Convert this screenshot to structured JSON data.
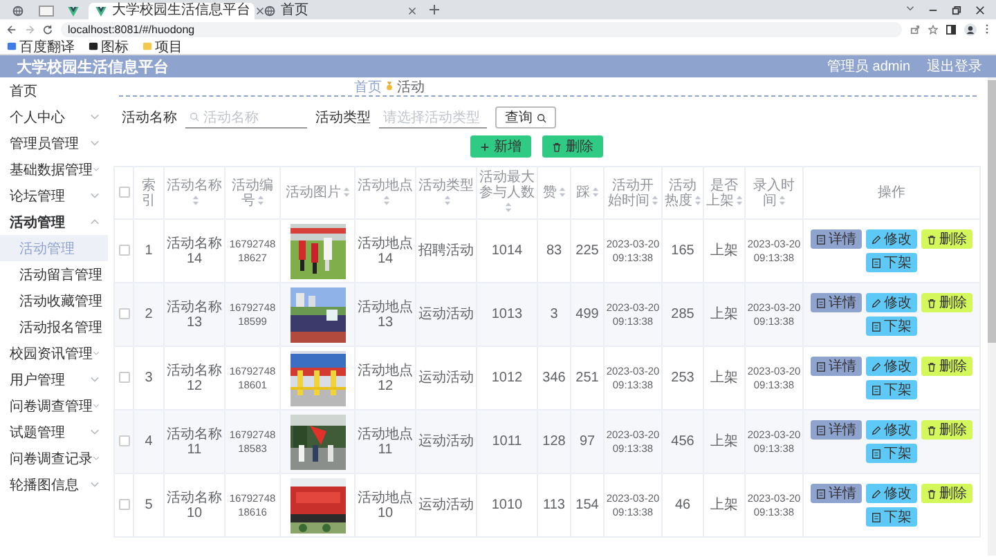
{
  "browser": {
    "tabs": [
      {
        "title": "大学校园生活信息平台",
        "selected": true
      },
      {
        "title": "首页",
        "selected": false
      }
    ],
    "address": "localhost:8081/#/huodong",
    "bookmarks": [
      "百度翻译",
      "图标",
      "项目"
    ]
  },
  "header": {
    "title": "大学校园生活信息平台",
    "user": "管理员 admin",
    "logout": "退出登录"
  },
  "sidebar": {
    "items": [
      {
        "label": "首页",
        "expandable": false,
        "expanded": false
      },
      {
        "label": "个人中心",
        "expandable": true,
        "expanded": false
      },
      {
        "label": "管理员管理",
        "expandable": true,
        "expanded": false
      },
      {
        "label": "基础数据管理",
        "expandable": true,
        "expanded": false
      },
      {
        "label": "论坛管理",
        "expandable": true,
        "expanded": false
      },
      {
        "label": "活动管理",
        "expandable": true,
        "expanded": true,
        "children": [
          {
            "label": "活动管理",
            "selected": true
          },
          {
            "label": "活动留言管理",
            "selected": false
          },
          {
            "label": "活动收藏管理",
            "selected": false
          },
          {
            "label": "活动报名管理",
            "selected": false
          }
        ]
      },
      {
        "label": "校园资讯管理",
        "expandable": true,
        "expanded": false
      },
      {
        "label": "用户管理",
        "expandable": true,
        "expanded": false
      },
      {
        "label": "问卷调查管理",
        "expandable": true,
        "expanded": false
      },
      {
        "label": "试题管理",
        "expandable": true,
        "expanded": false
      },
      {
        "label": "问卷调查记录",
        "expandable": true,
        "expanded": false
      },
      {
        "label": "轮播图信息",
        "expandable": true,
        "expanded": false
      }
    ]
  },
  "breadcrumb": [
    "首页",
    "活动"
  ],
  "search": {
    "fields": [
      {
        "kind": "text",
        "label": "活动名称",
        "placeholder": "活动名称"
      },
      {
        "kind": "select",
        "label": "活动类型",
        "placeholder": "请选择活动类型"
      }
    ],
    "button": "查询"
  },
  "toolbar": [
    "新增",
    "删除"
  ],
  "table": {
    "select_all_checked": false,
    "columns": [
      {
        "kind": "text",
        "label": "索引",
        "sortable": false
      },
      {
        "kind": "text",
        "label": "活动名称",
        "sortable": true
      },
      {
        "kind": "small",
        "label": "活动编号",
        "sortable": true
      },
      {
        "label": "活动图片",
        "sortable": true
      },
      {
        "kind": "text",
        "label": "活动地点",
        "sortable": true
      },
      {
        "kind": "text",
        "label": "活动类型",
        "sortable": true
      },
      {
        "kind": "text",
        "label": "活动最大参与人数",
        "sortable": true
      },
      {
        "kind": "text",
        "label": "赞",
        "sortable": true
      },
      {
        "kind": "text",
        "label": "踩",
        "sortable": true
      },
      {
        "kind": "small",
        "label": "活动开始时间",
        "sortable": true
      },
      {
        "kind": "text",
        "label": "活动热度",
        "sortable": true
      },
      {
        "kind": "text",
        "label": "是否上架",
        "sortable": true
      },
      {
        "kind": "small",
        "label": "录入时间",
        "sortable": true
      },
      {
        "kind": "actions",
        "label": "操作",
        "sortable": false
      }
    ],
    "rows": [
      {
        "checked": false,
        "cells": [
          "1",
          "活动名称14",
          "1679274818627",
          "",
          "活动地点14",
          "招聘活动",
          "1014",
          "83",
          "225",
          "2023-03-20 09:13:38",
          "165",
          "上架",
          "2023-03-20 09:13:38"
        ],
        "actions": [
          {
            "kind": "detail",
            "label": "详情"
          },
          {
            "kind": "edit",
            "label": "修改"
          },
          {
            "kind": "delete",
            "label": "删除"
          },
          {
            "kind": "offline",
            "label": "下架"
          }
        ]
      },
      {
        "checked": false,
        "cells": [
          "2",
          "活动名称13",
          "1679274818599",
          "",
          "活动地点13",
          "运动活动",
          "1013",
          "3",
          "499",
          "2023-03-20 09:13:38",
          "285",
          "上架",
          "2023-03-20 09:13:38"
        ],
        "actions": [
          {
            "kind": "detail",
            "label": "详情"
          },
          {
            "kind": "edit",
            "label": "修改"
          },
          {
            "kind": "delete",
            "label": "删除"
          },
          {
            "kind": "offline",
            "label": "下架"
          }
        ]
      },
      {
        "checked": false,
        "cells": [
          "3",
          "活动名称12",
          "1679274818601",
          "",
          "活动地点12",
          "运动活动",
          "1012",
          "346",
          "251",
          "2023-03-20 09:13:38",
          "253",
          "上架",
          "2023-03-20 09:13:38"
        ],
        "actions": [
          {
            "kind": "detail",
            "label": "详情"
          },
          {
            "kind": "edit",
            "label": "修改"
          },
          {
            "kind": "delete",
            "label": "删除"
          },
          {
            "kind": "offline",
            "label": "下架"
          }
        ]
      },
      {
        "checked": false,
        "cells": [
          "4",
          "活动名称11",
          "1679274818583",
          "",
          "活动地点11",
          "运动活动",
          "1011",
          "128",
          "97",
          "2023-03-20 09:13:38",
          "456",
          "上架",
          "2023-03-20 09:13:38"
        ],
        "actions": [
          {
            "kind": "detail",
            "label": "详情"
          },
          {
            "kind": "edit",
            "label": "修改"
          },
          {
            "kind": "delete",
            "label": "删除"
          },
          {
            "kind": "offline",
            "label": "下架"
          }
        ]
      },
      {
        "checked": false,
        "cells": [
          "5",
          "活动名称10",
          "1679274818616",
          "",
          "活动地点10",
          "运动活动",
          "1010",
          "113",
          "154",
          "2023-03-20 09:13:38",
          "46",
          "上架",
          "2023-03-20 09:13:38"
        ],
        "actions": [
          {
            "kind": "detail",
            "label": "详情"
          },
          {
            "kind": "edit",
            "label": "修改"
          },
          {
            "kind": "delete",
            "label": "删除"
          },
          {
            "kind": "offline",
            "label": "下架"
          }
        ]
      }
    ]
  }
}
